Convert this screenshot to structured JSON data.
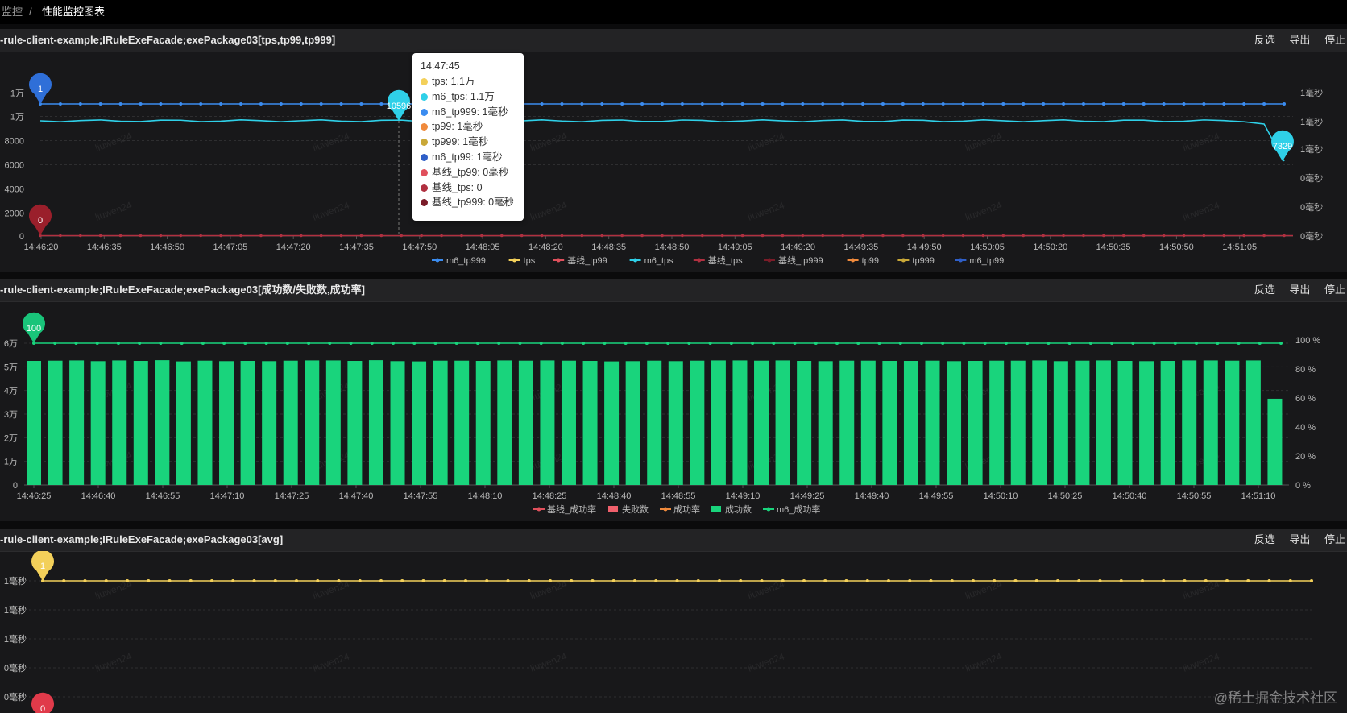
{
  "breadcrumb": {
    "parent": "监控",
    "separator": "/",
    "current": "性能监控图表"
  },
  "actions": {
    "invert": "反选",
    "export": "导出",
    "stop": "停止"
  },
  "watermark": "liuwen24",
  "site_watermark": "@稀土掘金技术社区",
  "colors": {
    "green": "#19d47c",
    "cyan": "#2fd0e8",
    "blue": "#3b7ff0",
    "darkred": "#9a1f2b",
    "yellow": "#f3d05a",
    "red": "#e03a4a"
  },
  "panels": [
    {
      "title": "-rule-client-example;IRuleExeFacade;exePackage03[tps,tp99,tp999]"
    },
    {
      "title": "-rule-client-example;IRuleExeFacade;exePackage03[成功数/失败数,成功率]"
    },
    {
      "title": "-rule-client-example;IRuleExeFacade;exePackage03[avg]"
    }
  ],
  "tooltip": {
    "time": "14:47:45",
    "rows": [
      {
        "label": "tps: 1.1万",
        "color": "#f3d05a"
      },
      {
        "label": "m6_tps: 1.1万",
        "color": "#2fd0e8"
      },
      {
        "label": "m6_tp999: 1毫秒",
        "color": "#3b8cf0"
      },
      {
        "label": "tp99: 1毫秒",
        "color": "#f08a3c"
      },
      {
        "label": "tp999: 1毫秒",
        "color": "#c9a838"
      },
      {
        "label": "m6_tp99: 1毫秒",
        "color": "#2f5fc8"
      },
      {
        "label": "基线_tp99: 0毫秒",
        "color": "#e0505c"
      },
      {
        "label": "基线_tps: 0",
        "color": "#b03040"
      },
      {
        "label": "基线_tp999: 0毫秒",
        "color": "#7a1c28"
      }
    ]
  },
  "chart_data": [
    {
      "type": "line",
      "x_ticks": [
        "14:46:20",
        "14:46:35",
        "14:46:50",
        "14:47:05",
        "14:47:20",
        "14:47:35",
        "14:47:50",
        "14:48:05",
        "14:48:20",
        "14:48:35",
        "14:48:50",
        "14:49:05",
        "14:49:20",
        "14:49:35",
        "14:49:50",
        "14:50:05",
        "14:50:20",
        "14:50:35",
        "14:50:50",
        "14:51:05"
      ],
      "y_left_ticks": [
        "0",
        "2000",
        "4000",
        "6000",
        "8000",
        "1万",
        "1万"
      ],
      "y_right_ticks": [
        "0毫秒",
        "0毫秒",
        "0毫秒",
        "1毫秒",
        "1毫秒",
        "1毫秒"
      ],
      "ylim_left": [
        0,
        12000
      ],
      "series": [
        {
          "name": "m6_tp999",
          "color": "#3b8cf0",
          "value": 1,
          "unit": "毫秒"
        },
        {
          "name": "tps",
          "color": "#f3d05a"
        },
        {
          "name": "基线_tp99",
          "color": "#e0505c"
        },
        {
          "name": "m6_tps",
          "color": "#2fd0e8",
          "value": 10596
        },
        {
          "name": "基线_tps",
          "color": "#b03040",
          "value": 0
        },
        {
          "name": "基线_tp999",
          "color": "#7a1c28"
        },
        {
          "name": "tp99",
          "color": "#f08a3c"
        },
        {
          "name": "tp999",
          "color": "#c9a838"
        },
        {
          "name": "m6_tp99",
          "color": "#2f5fc8"
        }
      ],
      "markers": [
        {
          "label": "1",
          "series": "m6_tp999",
          "color": "#2f6fd8"
        },
        {
          "label": "10596",
          "series": "m6_tps",
          "time": "14:47:45",
          "color": "#2fd0e8"
        },
        {
          "label": "7329",
          "series": "m6_tps",
          "color": "#2fd0e8"
        },
        {
          "label": "0",
          "series": "基线_tps",
          "color": "#9a1f2b"
        }
      ]
    },
    {
      "type": "bar",
      "x_ticks": [
        "14:46:25",
        "14:46:40",
        "14:46:55",
        "14:47:10",
        "14:47:25",
        "14:47:40",
        "14:47:55",
        "14:48:10",
        "14:48:25",
        "14:48:40",
        "14:48:55",
        "14:49:10",
        "14:49:25",
        "14:49:40",
        "14:49:55",
        "14:50:10",
        "14:50:25",
        "14:50:40",
        "14:50:55",
        "14:51:10"
      ],
      "y_left_ticks": [
        "0",
        "1万",
        "2万",
        "3万",
        "4万",
        "5万",
        "6万"
      ],
      "y_right_ticks": [
        "0 %",
        "20 %",
        "40 %",
        "60 %",
        "80 %",
        "100 %"
      ],
      "ylim_left": [
        0,
        60000
      ],
      "series": [
        {
          "name": "基线_成功率",
          "color": "#e0505c"
        },
        {
          "name": "失败数",
          "color": "#f0606c"
        },
        {
          "name": "成功率",
          "color": "#f08a3c"
        },
        {
          "name": "成功数",
          "color": "#19d47c",
          "values": [
            52500,
            52600,
            52700,
            52400,
            52700,
            52500,
            52800,
            52300,
            52600,
            52400,
            52500,
            52400,
            52600,
            52700,
            52700,
            52500,
            52800,
            52400,
            52300,
            52600,
            52600,
            52500,
            52700,
            52600,
            52700,
            52600,
            52500,
            52300,
            52400,
            52600,
            52400,
            52600,
            52700,
            52700,
            52600,
            52700,
            52500,
            52400,
            52600,
            52600,
            52500,
            52500,
            52600,
            52400,
            52500,
            52600,
            52600,
            52700,
            52400,
            52600,
            52700,
            52500,
            52400,
            52500,
            52700,
            52700,
            52600,
            52700,
            36500
          ]
        },
        {
          "name": "m6_成功率",
          "color": "#19d47c",
          "value": 100
        }
      ],
      "markers": [
        {
          "label": "100",
          "series": "m6_成功率",
          "color": "#19c47a"
        }
      ]
    },
    {
      "type": "line",
      "y_left_ticks": [
        "0毫秒",
        "0毫秒",
        "1毫秒",
        "1毫秒",
        "1毫秒"
      ],
      "series": [
        {
          "name": "avg",
          "color": "#f3d05a",
          "value": 1,
          "unit": "毫秒"
        }
      ],
      "markers": [
        {
          "label": "1",
          "color": "#f3d05a"
        },
        {
          "label": "0",
          "color": "#e03a4a"
        }
      ]
    }
  ]
}
